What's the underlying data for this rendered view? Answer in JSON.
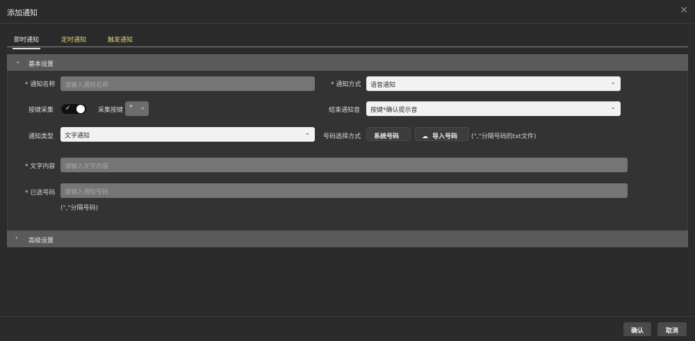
{
  "dialog": {
    "title": "添加通知",
    "close_icon": "close-icon"
  },
  "tabs": [
    {
      "label": "即时通知",
      "active": true
    },
    {
      "label": "定时通知",
      "active": false
    },
    {
      "label": "触发通知",
      "active": false
    }
  ],
  "basic": {
    "header": "基本设置",
    "name_label": "通知名称",
    "name_placeholder": "请输入通知名称",
    "method_label": "通知方式",
    "method_value": "语音通知",
    "key_collect_label": "按键采集",
    "key_collect_on": true,
    "collect_key_label": "采集按键",
    "collect_key_value": "*",
    "end_sound_label": "结束通知音",
    "end_sound_value": "按键*确认提示音",
    "type_label": "通知类型",
    "type_value": "文字通知",
    "number_select_label": "号码选择方式",
    "system_number_button": "系统号码",
    "import_number_button": "导入号码",
    "import_hint": "(\",\"分隔号码的txt文件)",
    "text_label": "文字内容",
    "text_placeholder": "请输入文字内容",
    "selected_label": "已选号码",
    "selected_placeholder": "请输入通知号码",
    "selected_hint": "(\",\"分隔号码)",
    "required_mark": "*"
  },
  "advanced": {
    "header": "高级设置"
  },
  "footer": {
    "confirm": "确认",
    "cancel": "取消"
  },
  "colors": {
    "accent_tab": "#e4d17a",
    "panel_header": "#5a5a5a",
    "input_bg": "#757575"
  }
}
